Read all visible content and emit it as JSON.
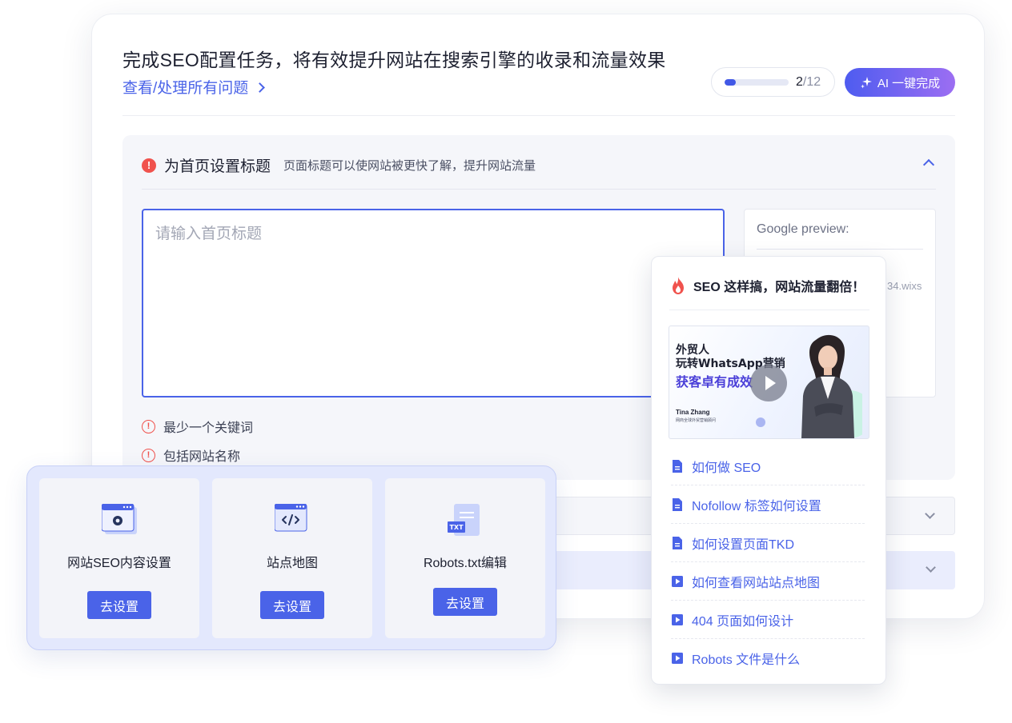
{
  "header": {
    "headline": "完成SEO配置任务，将有效提升网站在搜索引擎的收录和流量效果",
    "view_all_link": "查看/处理所有问题",
    "progress": {
      "done": "2",
      "total": "/12",
      "fraction": 0.17
    },
    "ai_button": "AI 一键完成"
  },
  "task": {
    "title": "为首页设置标题",
    "description": "页面标题可以使网站被更快了解，提升网站流量",
    "input_placeholder": "请输入首页标题",
    "google_preview_label": "Google preview:",
    "google_preview_url": "34.wixs",
    "requirements": [
      "最少一个关键词",
      "包括网站名称"
    ]
  },
  "tools": [
    {
      "label": "网站SEO内容设置",
      "button": "去设置",
      "icon": "settings-window-icon"
    },
    {
      "label": "站点地图",
      "button": "去设置",
      "icon": "code-window-icon"
    },
    {
      "label": "Robots.txt编辑",
      "button": "去设置",
      "icon": "txt-file-icon"
    }
  ],
  "popup": {
    "title": "SEO 这样搞，网站流量翻倍！",
    "video": {
      "line1": "外贸人",
      "line2": "玩转WhatsApp营销",
      "line3": "获客卓有成效",
      "presenter": "Tina Zhang",
      "presenter_subtitle": "网商全球外贸营销顾问"
    },
    "links": [
      {
        "label": "如何做 SEO",
        "icon": "document-icon"
      },
      {
        "label": "Nofollow 标签如何设置",
        "icon": "document-icon"
      },
      {
        "label": "如何设置页面TKD",
        "icon": "document-icon"
      },
      {
        "label": "如何查看网站站点地图",
        "icon": "video-icon"
      },
      {
        "label": "404 页面如何设计",
        "icon": "video-icon"
      },
      {
        "label": "Robots 文件是什么",
        "icon": "video-icon"
      }
    ]
  },
  "colors": {
    "accent": "#4a63e8",
    "warning": "#f0524d",
    "ai_gradient_start": "#4e5cf0",
    "ai_gradient_end": "#9c6ef2"
  }
}
